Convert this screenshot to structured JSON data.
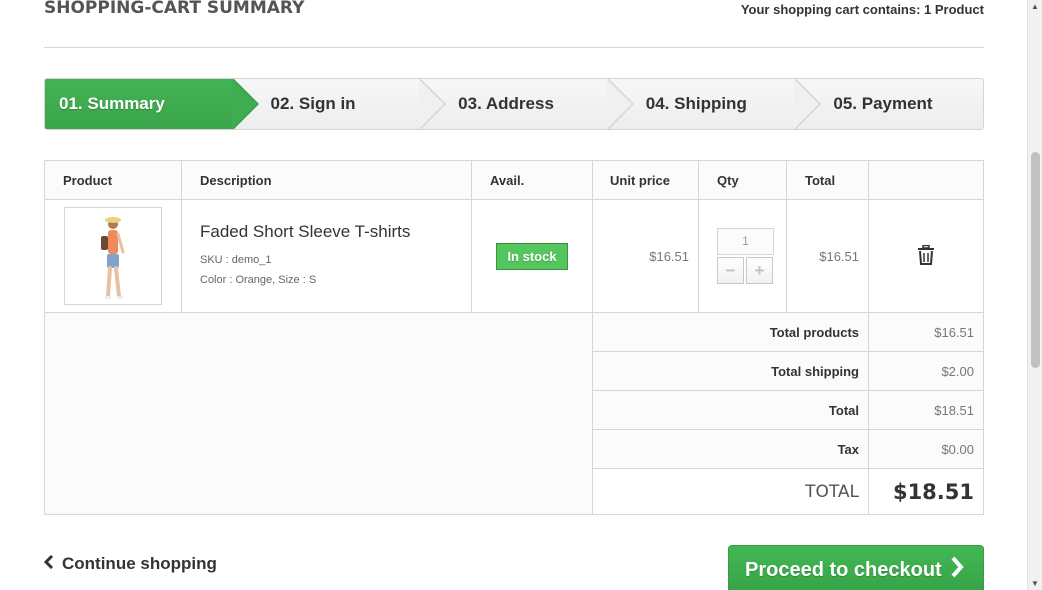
{
  "header": {
    "title": "SHOPPING-CART SUMMARY",
    "cart_count": "Your shopping cart contains: 1 Product"
  },
  "steps": [
    {
      "label": "01. Summary",
      "active": true
    },
    {
      "label": "02. Sign in",
      "active": false
    },
    {
      "label": "03. Address",
      "active": false
    },
    {
      "label": "04. Shipping",
      "active": false
    },
    {
      "label": "05. Payment",
      "active": false
    }
  ],
  "table": {
    "columns": [
      "Product",
      "Description",
      "Avail.",
      "Unit price",
      "Qty",
      "Total"
    ],
    "items": [
      {
        "name": "Faded Short Sleeve T-shirts",
        "sku": "SKU : demo_1",
        "attributes": "Color : Orange, Size : S",
        "availability": "In stock",
        "unit_price": "$16.51",
        "qty": "1",
        "total": "$16.51"
      }
    ]
  },
  "summary": {
    "total_products_label": "Total products",
    "total_products": "$16.51",
    "total_shipping_label": "Total shipping",
    "total_shipping": "$2.00",
    "total_label": "Total",
    "total": "$18.51",
    "tax_label": "Tax",
    "tax": "$0.00",
    "grand_label": "TOTAL",
    "grand_total": "$18.51"
  },
  "actions": {
    "continue_label": "Continue shopping",
    "checkout_label": "Proceed to checkout"
  },
  "icons": {
    "delete": "trash-icon",
    "continue": "chevron-left-icon",
    "checkout": "chevron-right-icon"
  },
  "colors": {
    "accent_green": "#3fab51",
    "stock_green": "#55c65e"
  }
}
